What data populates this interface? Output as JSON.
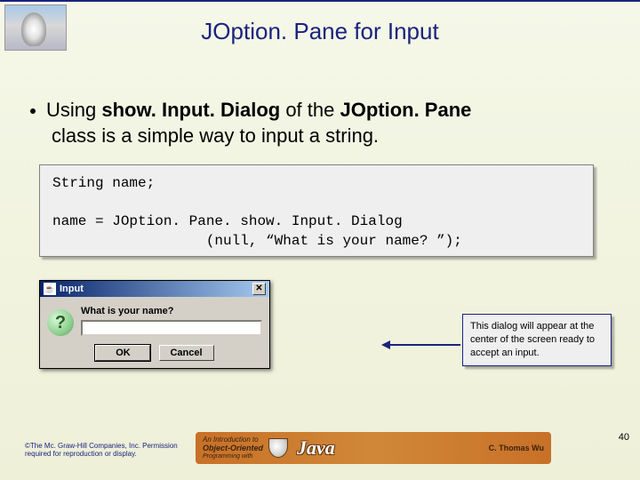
{
  "title": "JOption. Pane for Input",
  "bullet": {
    "part1": "Using ",
    "bold1": "show. Input. Dialog",
    "part2": " of the ",
    "bold2": "JOption. Pane",
    "part3": "class is a simple way to input a string."
  },
  "code": "String name;\n\nname = JOption. Pane. show. Input. Dialog\n                  (null, “What is your name? ”);",
  "dialog": {
    "title": "Input",
    "prompt": "What is your name?",
    "ok": "OK",
    "cancel": "Cancel",
    "close_glyph": "✕",
    "question_glyph": "?"
  },
  "note": "This dialog will appear at the center of the screen ready to accept an input.",
  "copyright": "©The Mc. Graw-Hill Companies, Inc. Permission required for reproduction or display.",
  "banner": {
    "line1": "An Introduction to",
    "line2": "Object-Oriented",
    "line3": "Programming with",
    "java": "Java",
    "author": "C. Thomas Wu"
  },
  "page_number": "40",
  "java_cup_glyph": "☕"
}
